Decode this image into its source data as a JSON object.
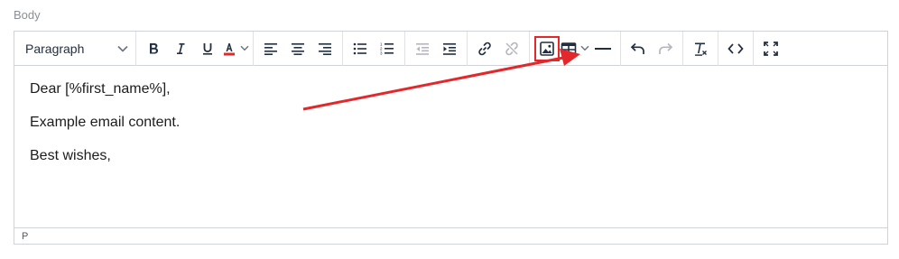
{
  "field": {
    "label": "Body"
  },
  "toolbar": {
    "block_format": "Paragraph",
    "icons": {
      "bold": "bold-icon",
      "italic": "italic-icon",
      "underline": "underline-icon",
      "text_color": "text-color-icon",
      "align_left": "align-left-icon",
      "align_center": "align-center-icon",
      "align_right": "align-right-icon",
      "bullet_list": "bullet-list-icon",
      "numbered_list": "numbered-list-icon",
      "outdent": "outdent-icon",
      "indent": "indent-icon",
      "link": "link-icon",
      "unlink": "unlink-icon",
      "image": "image-icon",
      "table": "table-icon",
      "horizontal_rule": "horizontal-line-icon",
      "undo": "undo-icon",
      "redo": "redo-icon",
      "clear_formatting": "clear-formatting-icon",
      "source_code": "source-code-icon",
      "fullscreen": "fullscreen-icon"
    },
    "text_color_swatch": "#e3272a"
  },
  "content": {
    "paragraphs": [
      "Dear [%first_name%],",
      "Example email content.",
      "Best wishes,"
    ]
  },
  "statusbar": {
    "path": "P"
  },
  "annotation": {
    "highlight_color": "#e3272a",
    "arrow_color": "#e3272a"
  }
}
